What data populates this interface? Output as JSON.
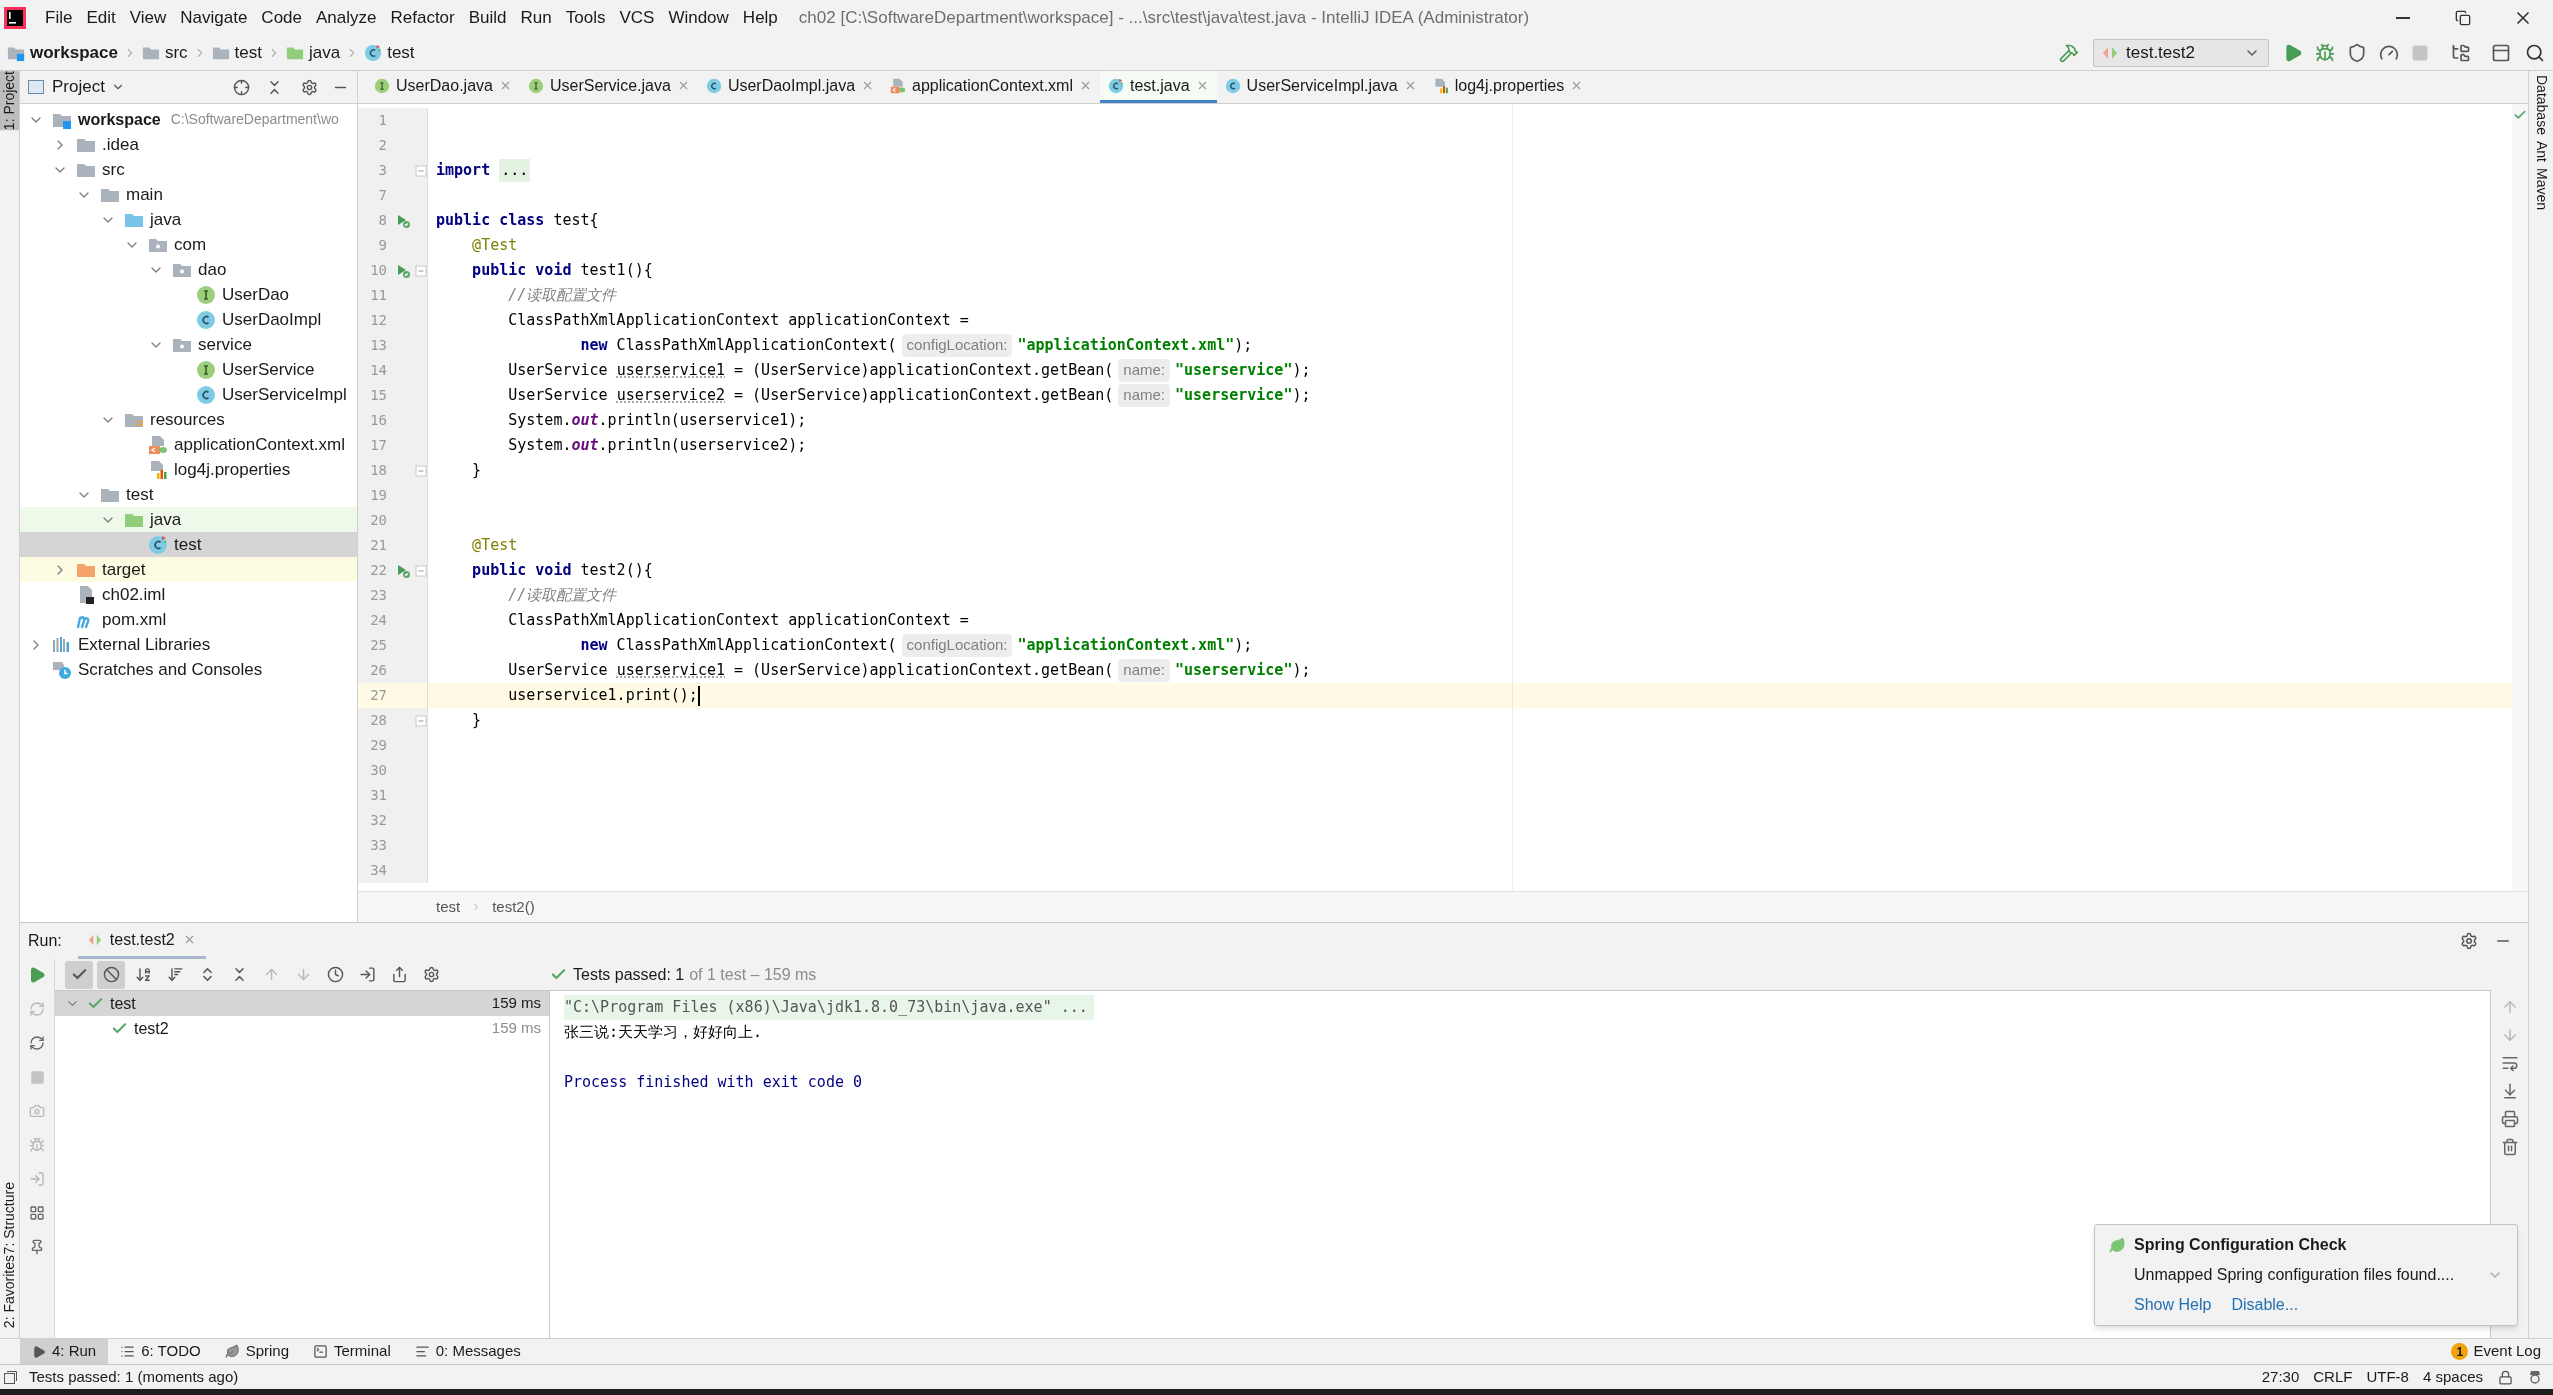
{
  "menu": [
    "File",
    "Edit",
    "View",
    "Navigate",
    "Code",
    "Analyze",
    "Refactor",
    "Build",
    "Run",
    "Tools",
    "VCS",
    "Window",
    "Help"
  ],
  "window_title": "ch02 [C:\\SoftwareDepartment\\workspace] - ...\\src\\test\\java\\test.java - IntelliJ IDEA (Administrator)",
  "breadcrumbs": [
    {
      "label": "workspace",
      "kind": "module"
    },
    {
      "label": "src",
      "kind": "folder"
    },
    {
      "label": "test",
      "kind": "folder"
    },
    {
      "label": "java",
      "kind": "test-folder"
    },
    {
      "label": "test",
      "kind": "test-class"
    }
  ],
  "run_config": "test.test2",
  "left_stripe_top": [
    {
      "label": "1: Project",
      "selected": true
    }
  ],
  "left_stripe_bottom": [
    {
      "label": "7: Structure",
      "selected": false
    },
    {
      "label": "2: Favorites",
      "selected": false
    }
  ],
  "right_stripe": [
    "Database",
    "Ant",
    "Maven"
  ],
  "project": {
    "title": "Project",
    "tree": [
      {
        "label": "workspace",
        "kind": "module",
        "path": "C:\\SoftwareDepartment\\wo",
        "expanded": true,
        "selected": false,
        "children": [
          {
            "label": ".idea",
            "kind": "folder",
            "expanded": false,
            "selected": false
          },
          {
            "label": "src",
            "kind": "folder",
            "expanded": true,
            "selected": false,
            "children": [
              {
                "label": "main",
                "kind": "folder",
                "expanded": true,
                "selected": false,
                "children": [
                  {
                    "label": "java",
                    "kind": "source-folder",
                    "expanded": true,
                    "selected": false,
                    "children": [
                      {
                        "label": "com",
                        "kind": "package",
                        "expanded": true,
                        "selected": false,
                        "children": [
                          {
                            "label": "dao",
                            "kind": "package",
                            "expanded": true,
                            "selected": false,
                            "children": [
                              {
                                "label": "UserDao",
                                "kind": "interface",
                                "selected": false
                              },
                              {
                                "label": "UserDaoImpl",
                                "kind": "class",
                                "selected": false
                              }
                            ]
                          },
                          {
                            "label": "service",
                            "kind": "package",
                            "expanded": true,
                            "selected": false,
                            "children": [
                              {
                                "label": "UserService",
                                "kind": "interface",
                                "selected": false
                              },
                              {
                                "label": "UserServiceImpl",
                                "kind": "class",
                                "selected": false
                              }
                            ]
                          }
                        ]
                      }
                    ]
                  },
                  {
                    "label": "resources",
                    "kind": "resources-folder",
                    "expanded": true,
                    "selected": false,
                    "children": [
                      {
                        "label": "applicationContext.xml",
                        "kind": "xml",
                        "selected": false
                      },
                      {
                        "label": "log4j.properties",
                        "kind": "properties",
                        "selected": false
                      }
                    ]
                  }
                ]
              },
              {
                "label": "test",
                "kind": "folder",
                "expanded": true,
                "selected": false,
                "children": [
                  {
                    "label": "java",
                    "kind": "test-folder",
                    "expanded": true,
                    "selected": false,
                    "children": [
                      {
                        "label": "test",
                        "kind": "test-class",
                        "selected": true
                      }
                    ]
                  }
                ]
              }
            ]
          },
          {
            "label": "target",
            "kind": "excluded-folder",
            "expanded": false,
            "selected": false
          },
          {
            "label": "ch02.iml",
            "kind": "iml",
            "selected": false
          },
          {
            "label": "pom.xml",
            "kind": "maven",
            "selected": false
          }
        ]
      },
      {
        "label": "External Libraries",
        "kind": "libraries",
        "expanded": false,
        "selected": false
      },
      {
        "label": "Scratches and Consoles",
        "kind": "scratches",
        "selected": false
      }
    ]
  },
  "editor_tabs": [
    {
      "label": "UserDao.java",
      "kind": "interface",
      "selected": false
    },
    {
      "label": "UserService.java",
      "kind": "interface",
      "selected": false
    },
    {
      "label": "UserDaoImpl.java",
      "kind": "class",
      "selected": false
    },
    {
      "label": "applicationContext.xml",
      "kind": "xml",
      "selected": false
    },
    {
      "label": "test.java",
      "kind": "test-class",
      "selected": true
    },
    {
      "label": "UserServiceImpl.java",
      "kind": "class",
      "selected": false
    },
    {
      "label": "log4j.properties",
      "kind": "properties",
      "selected": false
    }
  ],
  "code_lines": [
    {
      "number": "1",
      "current": false,
      "run_marker": false,
      "fold_marker": false
    },
    {
      "number": "2",
      "current": false,
      "run_marker": false,
      "fold_marker": false
    },
    {
      "number": "3",
      "current": false,
      "run_marker": false,
      "fold_marker": true,
      "tokens": [
        {
          "kind": "kw",
          "text": "import "
        },
        {
          "kind": "folded",
          "text": "..."
        }
      ]
    },
    {
      "number": "7",
      "current": false,
      "run_marker": false,
      "fold_marker": false
    },
    {
      "number": "8",
      "current": false,
      "run_marker": true,
      "fold_marker": false,
      "tokens": [
        {
          "kind": "kw",
          "text": "public class"
        },
        {
          "kind": "plain",
          "text": " test{"
        }
      ]
    },
    {
      "number": "9",
      "current": false,
      "run_marker": false,
      "fold_marker": false,
      "tokens": [
        {
          "kind": "ann",
          "text": "    @Test"
        }
      ]
    },
    {
      "number": "10",
      "current": false,
      "run_marker": true,
      "fold_marker": true,
      "tokens": [
        {
          "kind": "kw",
          "text": "    public void"
        },
        {
          "kind": "plain",
          "text": " test1(){"
        }
      ]
    },
    {
      "number": "11",
      "current": false,
      "run_marker": false,
      "fold_marker": false,
      "tokens": [
        {
          "kind": "comment",
          "text": "        //读取配置文件"
        }
      ]
    },
    {
      "number": "12",
      "current": false,
      "run_marker": false,
      "fold_marker": false,
      "tokens": [
        {
          "kind": "plain",
          "text": "        ClassPathXmlApplicationContext applicationContext ="
        }
      ]
    },
    {
      "number": "13",
      "current": false,
      "run_marker": false,
      "fold_marker": false,
      "tokens": [
        {
          "kind": "kw",
          "text": "                new"
        },
        {
          "kind": "plain",
          "text": " ClassPathXmlApplicationContext("
        },
        {
          "kind": "hint",
          "text": "configLocation:"
        },
        {
          "kind": "str",
          "text": "\"applicationContext.xml\""
        },
        {
          "kind": "plain",
          "text": ");"
        }
      ]
    },
    {
      "number": "14",
      "current": false,
      "run_marker": false,
      "fold_marker": false,
      "tokens": [
        {
          "kind": "plain",
          "text": "        UserService "
        },
        {
          "kind": "var",
          "text": "userservice1"
        },
        {
          "kind": "plain",
          "text": " = (UserService)applicationContext.getBean("
        },
        {
          "kind": "hint",
          "text": "name:"
        },
        {
          "kind": "str",
          "text": "\"userservice\""
        },
        {
          "kind": "plain",
          "text": ");"
        }
      ]
    },
    {
      "number": "15",
      "current": false,
      "run_marker": false,
      "fold_marker": false,
      "tokens": [
        {
          "kind": "plain",
          "text": "        UserService "
        },
        {
          "kind": "var",
          "text": "userservice2"
        },
        {
          "kind": "plain",
          "text": " = (UserService)applicationContext.getBean("
        },
        {
          "kind": "hint",
          "text": "name:"
        },
        {
          "kind": "str",
          "text": "\"userservice\""
        },
        {
          "kind": "plain",
          "text": ");"
        }
      ]
    },
    {
      "number": "16",
      "current": false,
      "run_marker": false,
      "fold_marker": false,
      "tokens": [
        {
          "kind": "plain",
          "text": "        System."
        },
        {
          "kind": "static",
          "text": "out"
        },
        {
          "kind": "plain",
          "text": ".println(userservice1);"
        }
      ]
    },
    {
      "number": "17",
      "current": false,
      "run_marker": false,
      "fold_marker": false,
      "tokens": [
        {
          "kind": "plain",
          "text": "        System."
        },
        {
          "kind": "static",
          "text": "out"
        },
        {
          "kind": "plain",
          "text": ".println(userservice2);"
        }
      ]
    },
    {
      "number": "18",
      "current": false,
      "run_marker": false,
      "fold_marker": true,
      "tokens": [
        {
          "kind": "plain",
          "text": "    }"
        }
      ]
    },
    {
      "number": "19",
      "current": false,
      "run_marker": false,
      "fold_marker": false
    },
    {
      "number": "20",
      "current": false,
      "run_marker": false,
      "fold_marker": false
    },
    {
      "number": "21",
      "current": false,
      "run_marker": false,
      "fold_marker": false,
      "tokens": [
        {
          "kind": "ann",
          "text": "    @Test"
        }
      ]
    },
    {
      "number": "22",
      "current": false,
      "run_marker": true,
      "fold_marker": true,
      "tokens": [
        {
          "kind": "kw",
          "text": "    public void"
        },
        {
          "kind": "plain",
          "text": " test2(){"
        }
      ]
    },
    {
      "number": "23",
      "current": false,
      "run_marker": false,
      "fold_marker": false,
      "tokens": [
        {
          "kind": "comment",
          "text": "        //读取配置文件"
        }
      ]
    },
    {
      "number": "24",
      "current": false,
      "run_marker": false,
      "fold_marker": false,
      "tokens": [
        {
          "kind": "plain",
          "text": "        ClassPathXmlApplicationContext applicationContext ="
        }
      ]
    },
    {
      "number": "25",
      "current": false,
      "run_marker": false,
      "fold_marker": false,
      "tokens": [
        {
          "kind": "kw",
          "text": "                new"
        },
        {
          "kind": "plain",
          "text": " ClassPathXmlApplicationContext("
        },
        {
          "kind": "hint",
          "text": "configLocation:"
        },
        {
          "kind": "str",
          "text": "\"applicationContext.xml\""
        },
        {
          "kind": "plain",
          "text": ");"
        }
      ]
    },
    {
      "number": "26",
      "current": false,
      "run_marker": false,
      "fold_marker": false,
      "tokens": [
        {
          "kind": "plain",
          "text": "        UserService "
        },
        {
          "kind": "var",
          "text": "userservice1"
        },
        {
          "kind": "plain",
          "text": " = (UserService)applicationContext.getBean("
        },
        {
          "kind": "hint",
          "text": "name:"
        },
        {
          "kind": "str",
          "text": "\"userservice\""
        },
        {
          "kind": "plain",
          "text": ");"
        }
      ]
    },
    {
      "number": "27",
      "current": true,
      "run_marker": false,
      "fold_marker": false,
      "tokens": [
        {
          "kind": "plain",
          "text": "        userservice1.print();"
        }
      ]
    },
    {
      "number": "28",
      "current": false,
      "run_marker": false,
      "fold_marker": true,
      "tokens": [
        {
          "kind": "plain",
          "text": "    }"
        }
      ]
    },
    {
      "number": "29",
      "current": false,
      "run_marker": false,
      "fold_marker": false
    },
    {
      "number": "30",
      "current": false,
      "run_marker": false,
      "fold_marker": false
    },
    {
      "number": "31",
      "current": false,
      "run_marker": false,
      "fold_marker": false
    },
    {
      "number": "32",
      "current": false,
      "run_marker": false,
      "fold_marker": false
    },
    {
      "number": "33",
      "current": false,
      "run_marker": false,
      "fold_marker": false
    },
    {
      "number": "34",
      "current": false,
      "run_marker": false,
      "fold_marker": false
    }
  ],
  "editor_breadcrumbs": [
    "test",
    "test2()"
  ],
  "run_panel": {
    "label": "Run:",
    "tab": "test.test2",
    "show_passed": true,
    "show_ignored": true,
    "status_label": "Tests passed: 1",
    "status_detail": "of 1 test – 159 ms",
    "tests": [
      {
        "name": "test",
        "time": "159 ms",
        "passed": true,
        "expanded": true,
        "selected": true,
        "children": [
          {
            "name": "test2",
            "time": "159 ms",
            "passed": true,
            "selected": false
          }
        ]
      }
    ],
    "console": [
      {
        "kind": "command",
        "text": "\"C:\\Program Files (x86)\\Java\\jdk1.8.0_73\\bin\\java.exe\" ..."
      },
      {
        "kind": "output",
        "text": "张三说:天天学习，好好向上."
      },
      {
        "kind": "blank"
      },
      {
        "kind": "system",
        "text": "Process finished with exit code 0"
      }
    ]
  },
  "notification": {
    "title": "Spring Configuration Check",
    "body": "Unmapped Spring configuration files found....",
    "links": [
      "Show Help",
      "Disable..."
    ]
  },
  "bottom_tabs": [
    {
      "label": "4: Run",
      "kind": "run",
      "selected": true
    },
    {
      "label": "6: TODO",
      "kind": "todo",
      "selected": false
    },
    {
      "label": "Spring",
      "kind": "spring",
      "selected": false
    },
    {
      "label": "Terminal",
      "kind": "terminal",
      "selected": false
    },
    {
      "label": "0: Messages",
      "kind": "messages",
      "selected": false
    }
  ],
  "event_log": {
    "label": "Event Log",
    "count": "1"
  },
  "status_bar": {
    "message": "Tests passed: 1 (moments ago)",
    "items": [
      "27:30",
      "CRLF",
      "UTF-8",
      "4 spaces"
    ]
  }
}
